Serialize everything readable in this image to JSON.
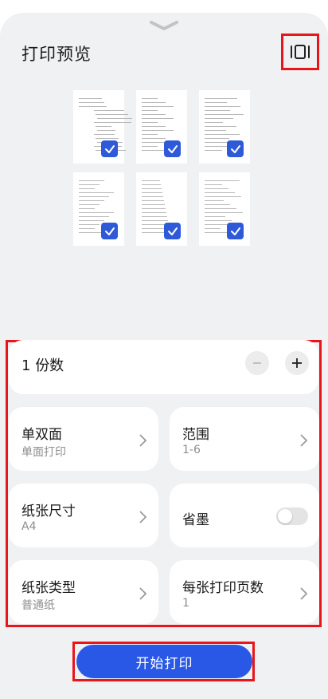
{
  "header": {
    "title": "打印预览",
    "handle_icon": "chevron-down-icon",
    "view_toggle_icon": "page-view-icon"
  },
  "preview": {
    "pages": [
      {
        "page": 1,
        "checked": true
      },
      {
        "page": 2,
        "checked": true
      },
      {
        "page": 3,
        "checked": true
      },
      {
        "page": 4,
        "checked": true
      },
      {
        "page": 5,
        "checked": true
      },
      {
        "page": 6,
        "checked": true
      }
    ],
    "check_color": "#2e59d9"
  },
  "copies": {
    "count": "1",
    "label": "份数"
  },
  "options": {
    "duplex": {
      "label": "单双面",
      "value": "单面打印"
    },
    "range": {
      "label": "范围",
      "value": "1-6"
    },
    "paper_size": {
      "label": "纸张尺寸",
      "value": "A4"
    },
    "ink_saver": {
      "label": "省墨",
      "enabled": false
    },
    "paper_type": {
      "label": "纸张类型",
      "value": "普通纸"
    },
    "pages_per_sheet": {
      "label": "每张打印页数",
      "value": "1"
    }
  },
  "actions": {
    "start_label": "开始打印",
    "accent": "#2a58e6",
    "highlight": "#e8151b"
  }
}
